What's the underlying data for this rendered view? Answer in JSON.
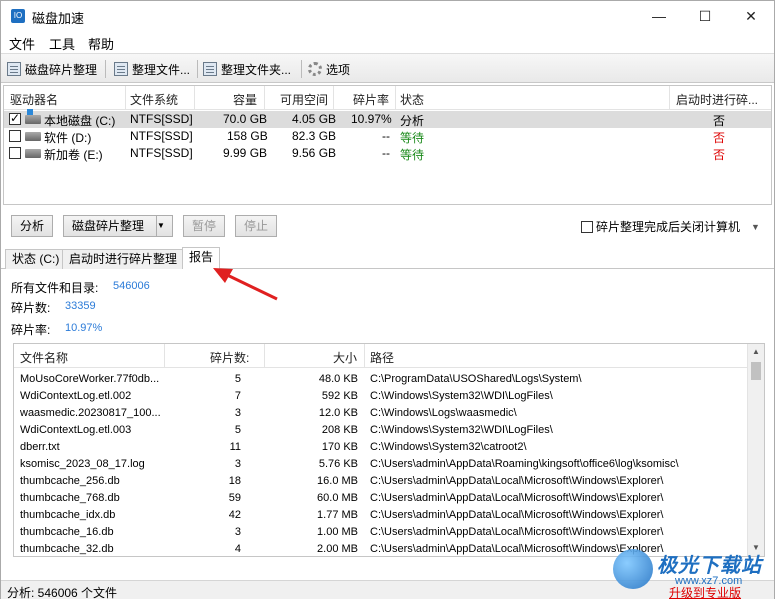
{
  "window": {
    "title": "磁盘加速",
    "app_icon_text": "IO"
  },
  "menu": [
    "文件",
    "工具",
    "帮助"
  ],
  "toolbar": {
    "defrag": "磁盘碎片整理",
    "defrag_file": "整理文件...",
    "defrag_folder": "整理文件夹...",
    "options": "选项"
  },
  "drives": {
    "columns": [
      "驱动器名",
      "文件系统",
      "容量",
      "可用空间",
      "碎片率",
      "状态",
      "启动时进行碎..."
    ],
    "rows": [
      {
        "checked": true,
        "name": "本地磁盘 (C:)",
        "fs": "NTFS[SSD]",
        "capacity": "70.0 GB",
        "free": "4.05 GB",
        "frag": "10.97%",
        "status": "分析",
        "boot": "否"
      },
      {
        "checked": false,
        "name": "软件 (D:)",
        "fs": "NTFS[SSD]",
        "capacity": "158 GB",
        "free": "82.3 GB",
        "frag": "--",
        "status": "等待",
        "boot": "否"
      },
      {
        "checked": false,
        "name": "新加卷 (E:)",
        "fs": "NTFS[SSD]",
        "capacity": "9.99 GB",
        "free": "9.56 GB",
        "frag": "--",
        "status": "等待",
        "boot": "否"
      }
    ]
  },
  "actions": {
    "analyze": "分析",
    "defrag": "磁盘碎片整理",
    "pause": "暂停",
    "stop": "停止",
    "shutdown_label": "碎片整理完成后关闭计算机"
  },
  "tabs": [
    "状态 (C:)",
    "启动时进行碎片整理",
    "报告"
  ],
  "report": {
    "all_files_label": "所有文件和目录:",
    "all_files_value": "546006",
    "fragments_label": "碎片数:",
    "fragments_value": "33359",
    "frag_rate_label": "碎片率:",
    "frag_rate_value": "10.97%"
  },
  "files": {
    "columns": [
      "文件名称",
      "碎片数:",
      "大小",
      "路径"
    ],
    "rows": [
      {
        "name": "MoUsoCoreWorker.77f0db...",
        "frags": "5",
        "size": "48.0 KB",
        "path": "C:\\ProgramData\\USOShared\\Logs\\System\\"
      },
      {
        "name": "WdiContextLog.etl.002",
        "frags": "7",
        "size": "592 KB",
        "path": "C:\\Windows\\System32\\WDI\\LogFiles\\"
      },
      {
        "name": "waasmedic.20230817_100...",
        "frags": "3",
        "size": "12.0 KB",
        "path": "C:\\Windows\\Logs\\waasmedic\\"
      },
      {
        "name": "WdiContextLog.etl.003",
        "frags": "5",
        "size": "208 KB",
        "path": "C:\\Windows\\System32\\WDI\\LogFiles\\"
      },
      {
        "name": "dberr.txt",
        "frags": "11",
        "size": "170 KB",
        "path": "C:\\Windows\\System32\\catroot2\\"
      },
      {
        "name": "ksomisc_2023_08_17.log",
        "frags": "3",
        "size": "5.76 KB",
        "path": "C:\\Users\\admin\\AppData\\Roaming\\kingsoft\\office6\\log\\ksomisc\\"
      },
      {
        "name": "thumbcache_256.db",
        "frags": "18",
        "size": "16.0 MB",
        "path": "C:\\Users\\admin\\AppData\\Local\\Microsoft\\Windows\\Explorer\\"
      },
      {
        "name": "thumbcache_768.db",
        "frags": "59",
        "size": "60.0 MB",
        "path": "C:\\Users\\admin\\AppData\\Local\\Microsoft\\Windows\\Explorer\\"
      },
      {
        "name": "thumbcache_idx.db",
        "frags": "42",
        "size": "1.77 MB",
        "path": "C:\\Users\\admin\\AppData\\Local\\Microsoft\\Windows\\Explorer\\"
      },
      {
        "name": "thumbcache_16.db",
        "frags": "3",
        "size": "1.00 MB",
        "path": "C:\\Users\\admin\\AppData\\Local\\Microsoft\\Windows\\Explorer\\"
      },
      {
        "name": "thumbcache_32.db",
        "frags": "4",
        "size": "2.00 MB",
        "path": "C:\\Users\\admin\\AppData\\Local\\Microsoft\\Windows\\Explorer\\"
      }
    ]
  },
  "status_bar": {
    "text": "分析: 546006 个文件",
    "upgrade": "升级到专业版"
  },
  "watermark": {
    "brand": "极光下载站",
    "url": "www.xz7.com"
  },
  "colors": {
    "link_blue": "#2b7bd8",
    "status_green": "#1a8a1a",
    "boot_red": "#dd0000",
    "annotation_red": "#e02020"
  }
}
